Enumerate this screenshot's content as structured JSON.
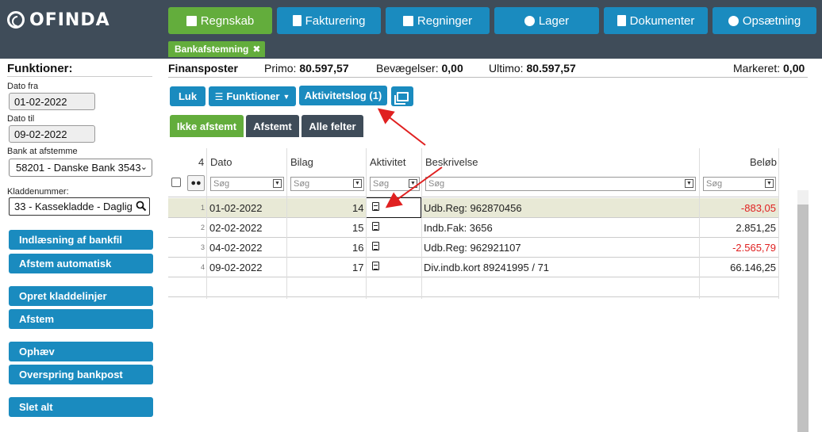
{
  "app": {
    "logo_text": "OFINDA"
  },
  "nav": [
    {
      "label": "Regnskab",
      "icon": "calendar-icon",
      "active": true
    },
    {
      "label": "Fakturering",
      "icon": "clipboard-icon"
    },
    {
      "label": "Regninger",
      "icon": "factory-icon"
    },
    {
      "label": "Lager",
      "icon": "cubes-icon"
    },
    {
      "label": "Dokumenter",
      "icon": "file-icon"
    },
    {
      "label": "Opsætning",
      "icon": "gear-icon"
    }
  ],
  "open_tab": {
    "label": "Bankafstemning",
    "close": "✖"
  },
  "sidebar": {
    "title": "Funktioner:",
    "date_from_label": "Dato fra",
    "date_from": "01-02-2022",
    "date_to_label": "Dato til",
    "date_to": "09-02-2022",
    "bank_label": "Bank at afstemme",
    "bank_value": "58201 - Danske Bank 3543",
    "journal_label": "Kladdenummer:",
    "journal_value": "33 - Kassekladde - Daglig",
    "buttons": [
      "Indlæsning af bankfil",
      "Afstem automatisk",
      "Opret kladdelinjer",
      "Afstem",
      "Ophæv",
      "Overspring bankpost",
      "Slet alt"
    ]
  },
  "info": {
    "title": "Finansposter",
    "primo_label": "Primo:",
    "primo": "80.597,57",
    "movements_label": "Bevægelser:",
    "movements": "0,00",
    "ultimo_label": "Ultimo:",
    "ultimo": "80.597,57",
    "marked_label": "Markeret:",
    "marked": "0,00"
  },
  "toolbar": {
    "close_label": "Luk",
    "functions_label": "Funktioner",
    "activity_log_label": "Aktivitetslog (1)"
  },
  "filter_tabs": [
    "Ikke afstemt",
    "Afstemt",
    "Alle felter"
  ],
  "grid": {
    "count": "4",
    "columns": [
      "Dato",
      "Bilag",
      "Aktivitet",
      "Beskrivelse",
      "Beløb"
    ],
    "filter_placeholder": "Søg",
    "rows": [
      {
        "n": "1",
        "date": "01-02-2022",
        "voucher": "14",
        "description": "Udb.Reg: 962870456",
        "amount": "-883,05",
        "negative": true
      },
      {
        "n": "2",
        "date": "02-02-2022",
        "voucher": "15",
        "description": "Indb.Fak: 3656",
        "amount": "2.851,25",
        "negative": false
      },
      {
        "n": "3",
        "date": "04-02-2022",
        "voucher": "16",
        "description": "Udb.Reg: 962921107",
        "amount": "-2.565,79",
        "negative": true
      },
      {
        "n": "4",
        "date": "09-02-2022",
        "voucher": "17",
        "description": "Div.indb.kort 89241995 / 71",
        "amount": "66.146,25",
        "negative": false
      }
    ]
  },
  "colors": {
    "blue": "#1a8bbf",
    "green": "#63ad3c",
    "dark": "#3f4c59",
    "negative": "#e02020",
    "annotation": "#e02020"
  }
}
